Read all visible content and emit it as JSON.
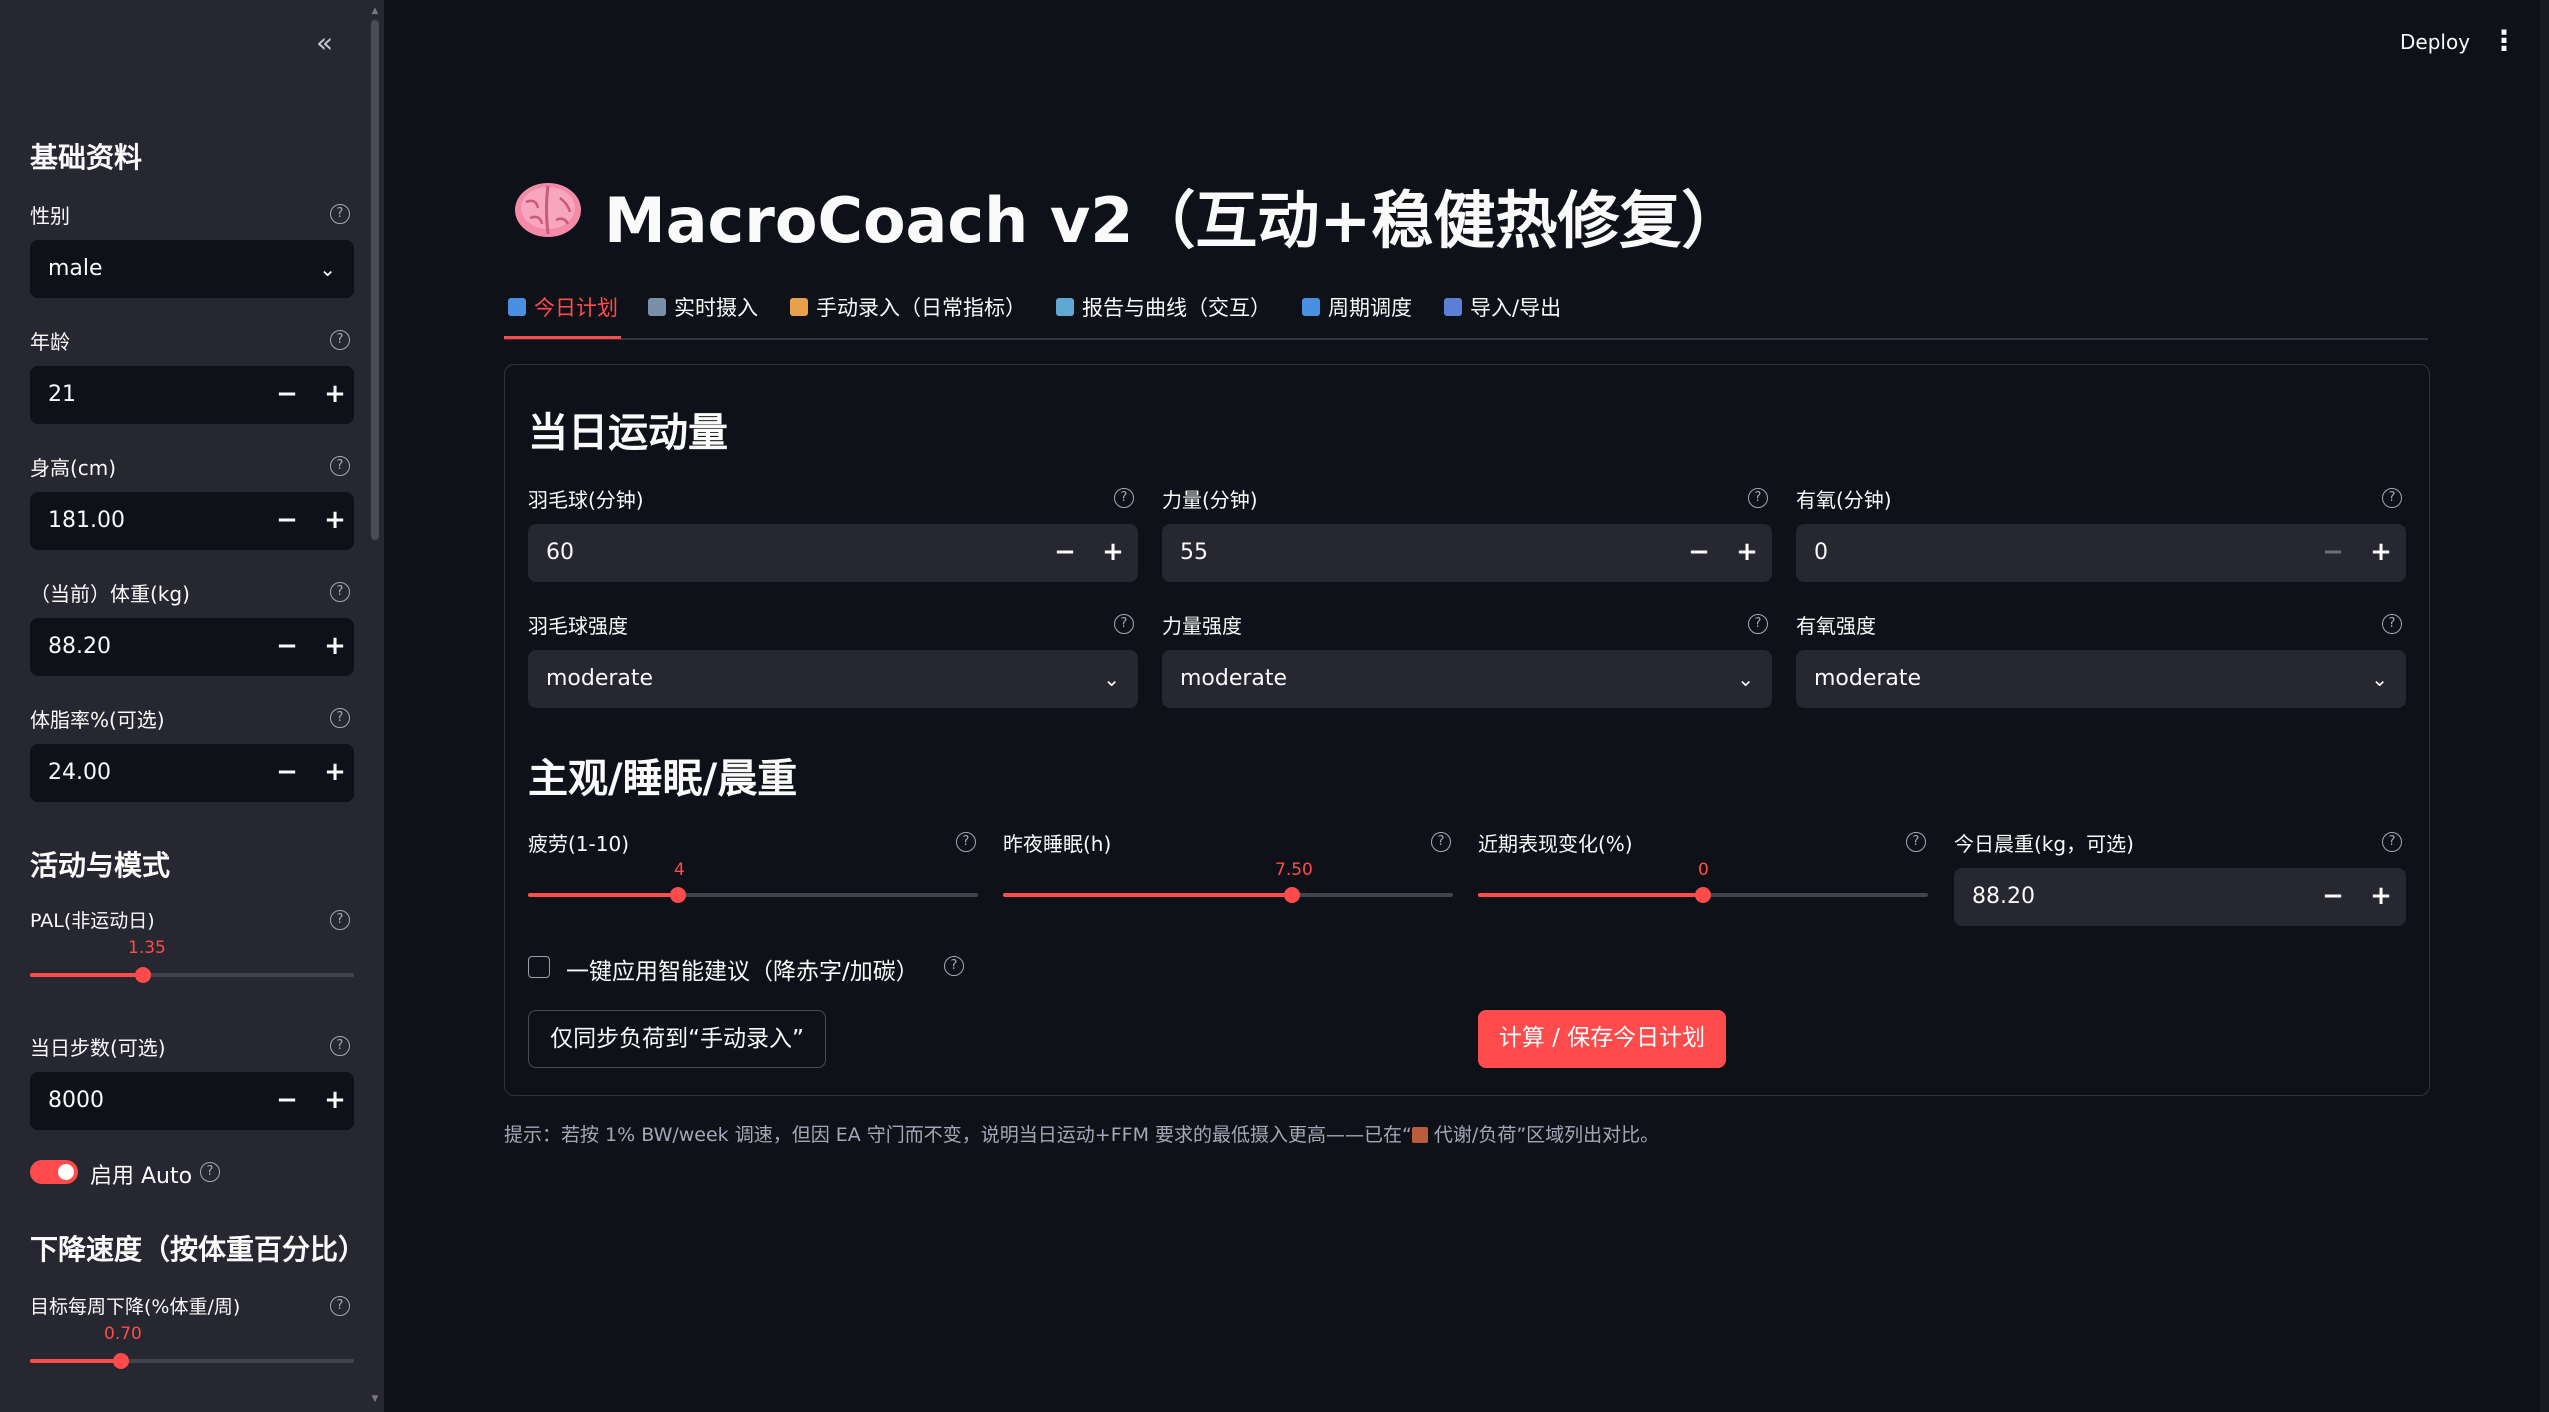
{
  "topbar": {
    "deploy": "Deploy",
    "menu_icon": "kebab-menu-icon"
  },
  "sidebar": {
    "basic_header": "基础资料",
    "gender": {
      "label": "性别",
      "value": "male"
    },
    "age": {
      "label": "年龄",
      "value": "21"
    },
    "height": {
      "label": "身高(cm)",
      "value": "181.00"
    },
    "weight": {
      "label": "（当前）体重(kg)",
      "value": "88.20"
    },
    "bodyfat": {
      "label": "体脂率%(可选)",
      "value": "24.00"
    },
    "activity_header": "活动与模式",
    "pal": {
      "label": "PAL(非运动日)",
      "value": "1.35",
      "fraction": 0.35
    },
    "steps": {
      "label": "当日步数(可选)",
      "value": "8000"
    },
    "auto": {
      "label": "启用 Auto",
      "enabled": true
    },
    "rate_header": "下降速度（按体重百分比）",
    "rate": {
      "label": "目标每周下降(%体重/周)",
      "value": "0.70",
      "fraction": 0.28
    }
  },
  "app": {
    "title": "MacroCoach v2（互动+稳健热修复）",
    "tabs": [
      {
        "label": "今日计划",
        "icon": "calendar-icon",
        "color": "#4a90e2"
      },
      {
        "label": "实时摄入",
        "icon": "camera-icon",
        "color": "#7b8fa8"
      },
      {
        "label": "手动录入（日常指标）",
        "icon": "memo-icon",
        "color": "#e8a14a"
      },
      {
        "label": "报告与曲线（交互）",
        "icon": "chart-icon",
        "color": "#5fa8d3"
      },
      {
        "label": "周期调度",
        "icon": "calendar-icon",
        "color": "#4a90e2"
      },
      {
        "label": "导入/导出",
        "icon": "inbox-icon",
        "color": "#5b7fd6"
      }
    ]
  },
  "exercise": {
    "header": "当日运动量",
    "badminton_min": {
      "label": "羽毛球(分钟)",
      "value": "60"
    },
    "strength_min": {
      "label": "力量(分钟)",
      "value": "55"
    },
    "cardio_min": {
      "label": "有氧(分钟)",
      "value": "0"
    },
    "badminton_int": {
      "label": "羽毛球强度",
      "value": "moderate"
    },
    "strength_int": {
      "label": "力量强度",
      "value": "moderate"
    },
    "cardio_int": {
      "label": "有氧强度",
      "value": "moderate"
    }
  },
  "subjective": {
    "header": "主观/睡眠/晨重",
    "fatigue": {
      "label": "疲劳(1-10)",
      "value": "4",
      "fraction": 0.333
    },
    "sleep": {
      "label": "昨夜睡眠(h)",
      "value": "7.50",
      "fraction": 0.643
    },
    "perf": {
      "label": "近期表现变化(%)",
      "value": "0",
      "fraction": 0.5
    },
    "morning_weight": {
      "label": "今日晨重(kg，可选)",
      "value": "88.20"
    },
    "smart_apply": "一键应用智能建议（降赤字/加碳）",
    "sync_button": "仅同步负荷到“手动录入”",
    "save_button": "计算 / 保存今日计划"
  },
  "tip": "提示：若按 1% BW/week 调速，但因 EA 守门而不变，说明当日运动+FFM 要求的最低摄入更高——已在“",
  "tip_tail": " 代谢/负荷”区域列出对比。",
  "tip_icon": "abacus-icon"
}
